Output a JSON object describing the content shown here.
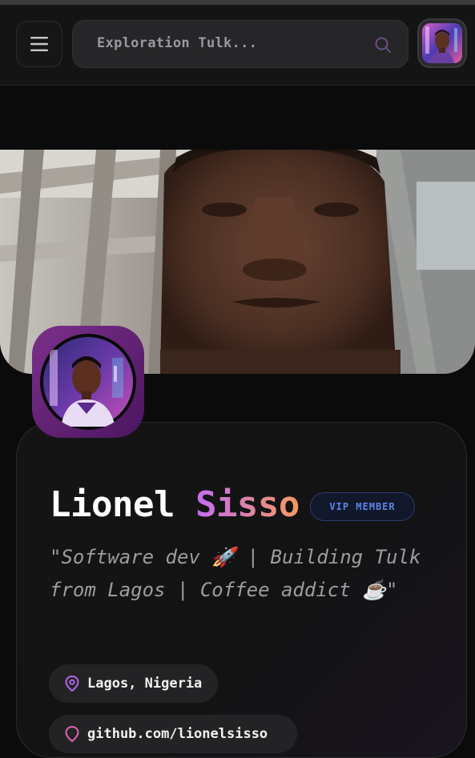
{
  "header": {
    "search_placeholder": "Exploration Tulk...",
    "icons": [
      "menu-icon",
      "search-icon",
      "avatar"
    ]
  },
  "profile": {
    "first_name": "Lionel",
    "last_name": "Sisso",
    "badge": "VIP MEMBER",
    "bio": "\"Software dev 🚀 | Building Tulk from Lagos | Coffee addict ☕\"",
    "location": "Lagos, Nigeria",
    "link_partial": "github.com/lionelsisso"
  },
  "colors": {
    "background": "#0b0b0c",
    "accent_gradient_start": "#c46cf4",
    "accent_gradient_end": "#f59a5e",
    "badge_text": "#5d84e6"
  }
}
